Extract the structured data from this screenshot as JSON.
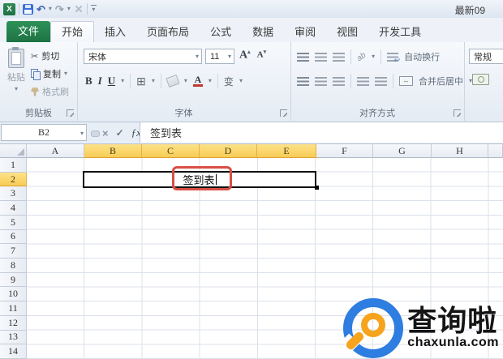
{
  "window": {
    "title": "最新09"
  },
  "quick_access": {
    "excel_glyph": "X",
    "undo_glyph": "↶",
    "redo_glyph": "↷"
  },
  "tabs": [
    {
      "label": "文件"
    },
    {
      "label": "开始"
    },
    {
      "label": "插入"
    },
    {
      "label": "页面布局"
    },
    {
      "label": "公式"
    },
    {
      "label": "数据"
    },
    {
      "label": "审阅"
    },
    {
      "label": "视图"
    },
    {
      "label": "开发工具"
    }
  ],
  "ribbon": {
    "clipboard": {
      "label": "剪贴板",
      "paste": "粘贴",
      "cut": "剪切",
      "copy": "复制",
      "format_painter": "格式刷",
      "cut_glyph": "✂"
    },
    "font": {
      "label": "字体",
      "font_name": "宋体",
      "font_size": "11",
      "bold": "B",
      "italic": "I",
      "underline": "U",
      "grow": "A",
      "shrink": "A",
      "borders_glyph": "⊞",
      "color_letter": "A",
      "phonetic": "变"
    },
    "alignment": {
      "label": "对齐方式",
      "orientation_glyph": "ab",
      "wrap_text": "自动换行",
      "merge_center": "合并后居中",
      "merge_glyph": "↔",
      "wrap_glyph": "↩"
    },
    "number": {
      "format": "常规"
    }
  },
  "formula_bar": {
    "name_box": "B2",
    "cancel_glyph": "×",
    "enter_glyph": "✓",
    "fx_glyph": "ƒx",
    "formula": "签到表"
  },
  "grid": {
    "columns": [
      "A",
      "B",
      "C",
      "D",
      "E",
      "F",
      "G",
      "H",
      ""
    ],
    "selected_columns": [
      "B",
      "C",
      "D",
      "E"
    ],
    "rows": [
      "1",
      "2",
      "3",
      "4",
      "5",
      "6",
      "7",
      "8",
      "9",
      "10",
      "11",
      "12",
      "13",
      "14"
    ],
    "selected_rows": [
      "2"
    ],
    "active_cell": {
      "reference": "B2",
      "merged_range": "B2:E2",
      "text": "签到表"
    }
  },
  "watermark": {
    "name": "查询啦",
    "domain": "chaxunla.com"
  },
  "colors": {
    "file_tab_green": "#1e7245",
    "header_highlight": "#fbd566",
    "annotation_red": "#d94f44",
    "selection_border": "#000000",
    "logo_blue": "#2e7de0",
    "logo_orange": "#f6a41d"
  }
}
